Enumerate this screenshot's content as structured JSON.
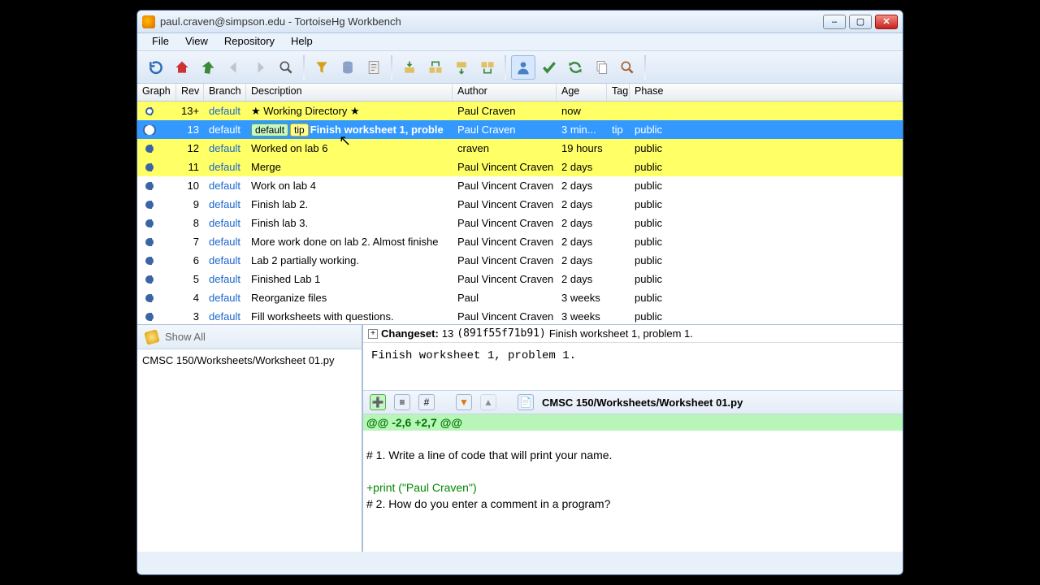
{
  "window": {
    "title": "paul.craven@simpson.edu - TortoiseHg Workbench"
  },
  "menu": [
    "File",
    "View",
    "Repository",
    "Help"
  ],
  "columns": {
    "graph": "Graph",
    "rev": "Rev",
    "branch": "Branch",
    "description": "Description",
    "author": "Author",
    "age": "Age",
    "tags": "Tag",
    "phase": "Phase"
  },
  "rows": [
    {
      "rev": "13+",
      "branch": "default",
      "desc": "★ Working Directory ★",
      "author": "Paul Craven",
      "age": "now",
      "tags": "",
      "phase": "",
      "working": true,
      "hl": true
    },
    {
      "rev": "13",
      "branch": "default",
      "desc": "Finish worksheet 1, proble",
      "author": "Paul Craven",
      "age": "3 min...",
      "tags": "tip",
      "phase": "public",
      "selected": true,
      "badge_branch": "default",
      "badge_tip": "tip",
      "hl": true
    },
    {
      "rev": "12",
      "branch": "default",
      "desc": "Worked on lab 6",
      "author": "craven",
      "age": "19 hours",
      "tags": "",
      "phase": "public",
      "hl": true
    },
    {
      "rev": "11",
      "branch": "default",
      "desc": "Merge",
      "author": "Paul Vincent Craven",
      "age": "2 days",
      "tags": "",
      "phase": "public",
      "hl": true
    },
    {
      "rev": "10",
      "branch": "default",
      "desc": "Work on lab 4",
      "author": "Paul Vincent Craven",
      "age": "2 days",
      "tags": "",
      "phase": "public"
    },
    {
      "rev": "9",
      "branch": "default",
      "desc": "Finish lab 2.",
      "author": "Paul Vincent Craven",
      "age": "2 days",
      "tags": "",
      "phase": "public"
    },
    {
      "rev": "8",
      "branch": "default",
      "desc": "Finish lab 3.",
      "author": "Paul Vincent Craven",
      "age": "2 days",
      "tags": "",
      "phase": "public"
    },
    {
      "rev": "7",
      "branch": "default",
      "desc": "More work done on lab 2. Almost finishe",
      "author": "Paul Vincent Craven",
      "age": "2 days",
      "tags": "",
      "phase": "public"
    },
    {
      "rev": "6",
      "branch": "default",
      "desc": "Lab 2 partially working.",
      "author": "Paul Vincent Craven",
      "age": "2 days",
      "tags": "",
      "phase": "public"
    },
    {
      "rev": "5",
      "branch": "default",
      "desc": "Finished Lab 1",
      "author": "Paul Vincent Craven",
      "age": "2 days",
      "tags": "",
      "phase": "public"
    },
    {
      "rev": "4",
      "branch": "default",
      "desc": "Reorganize files",
      "author": "Paul",
      "age": "3 weeks",
      "tags": "",
      "phase": "public"
    },
    {
      "rev": "3",
      "branch": "default",
      "desc": "Fill worksheets with questions.",
      "author": "Paul Vincent Craven",
      "age": "3 weeks",
      "tags": "",
      "phase": "public"
    }
  ],
  "showall": "Show All",
  "filelist": [
    "CMSC 150/Worksheets/Worksheet 01.py"
  ],
  "changeset": {
    "label": "Changeset:",
    "rev": "13",
    "hash": "(891f55f71b91)",
    "summary": "Finish worksheet 1, problem 1."
  },
  "commitmsg": "Finish worksheet 1, problem 1.",
  "diff": {
    "file": "CMSC 150/Worksheets/Worksheet 01.py",
    "lines": [
      {
        "t": "@@ -2,6 +2,7 @@",
        "cls": "dl-hunk"
      },
      {
        "t": " ",
        "cls": ""
      },
      {
        "t": "# 1. Write a line of code that will print your name.",
        "cls": ""
      },
      {
        "t": " ",
        "cls": ""
      },
      {
        "t": "+print (\"Paul Craven\")",
        "cls": "dl-add"
      },
      {
        "t": "# 2. How do you enter a comment in a program?",
        "cls": ""
      }
    ]
  }
}
